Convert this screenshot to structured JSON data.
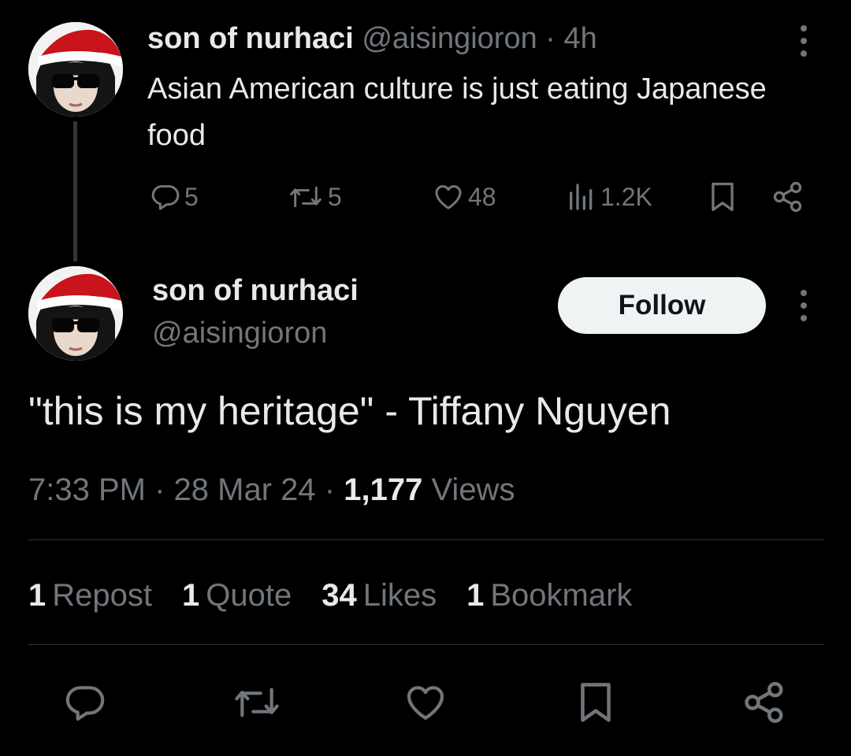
{
  "parent_tweet": {
    "display_name": "son of nurhaci",
    "handle": "@aisingioron",
    "separator": "·",
    "time_ago": "4h",
    "text": "Asian American culture is just eating Japanese food",
    "actions": {
      "replies": "5",
      "reposts": "5",
      "likes": "48",
      "views": "1.2K"
    }
  },
  "main_tweet": {
    "display_name": "son of nurhaci",
    "handle": "@aisingioron",
    "follow_label": "Follow",
    "text": "\"this is my heritage\" - Tiffany Nguyen",
    "time": "7:33 PM",
    "date": "28 Mar 24",
    "separator": "·",
    "views_count": "1,177",
    "views_label": "Views",
    "stats": {
      "reposts_count": "1",
      "reposts_label": "Repost",
      "quotes_count": "1",
      "quotes_label": "Quote",
      "likes_count": "34",
      "likes_label": "Likes",
      "bookmarks_count": "1",
      "bookmarks_label": "Bookmark"
    }
  },
  "icons": {
    "reply": "reply-icon",
    "repost": "repost-icon",
    "like": "heart-icon",
    "views": "views-icon",
    "bookmark": "bookmark-icon",
    "share": "share-icon",
    "more": "more-icon"
  },
  "colors": {
    "background": "#000000",
    "text_primary": "#e7e9ea",
    "text_secondary": "#71767b",
    "divider": "#2f3336",
    "follow_button_bg": "#eff3f4",
    "follow_button_text": "#0f1419"
  }
}
